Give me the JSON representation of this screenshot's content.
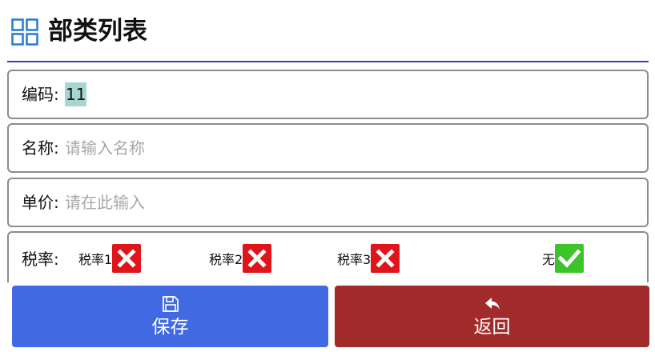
{
  "header": {
    "title": "部类列表",
    "icon": "grid-icon",
    "rule_color": "#3a3fa3"
  },
  "form": {
    "code": {
      "label": "编码:",
      "value": "11"
    },
    "name": {
      "label": "名称:",
      "placeholder": "请输入名称"
    },
    "price": {
      "label": "单价:",
      "placeholder": "请在此输入"
    },
    "tax": {
      "label": "税率:",
      "options": [
        {
          "label": "税率1",
          "checked": false,
          "icon": "close-icon"
        },
        {
          "label": "税率2",
          "checked": false,
          "icon": "close-icon"
        },
        {
          "label": "税率3",
          "checked": false,
          "icon": "close-icon"
        },
        {
          "label": "无",
          "checked": true,
          "icon": "check-icon"
        }
      ]
    }
  },
  "buttons": {
    "save": {
      "label": "保存",
      "icon": "save-icon",
      "color": "#4169e1"
    },
    "back": {
      "label": "返回",
      "icon": "reply-icon",
      "color": "#a12a2a"
    }
  },
  "colors": {
    "unchecked": "#e0141b",
    "checked": "#3cc42a",
    "selection": "#a6d6cf"
  }
}
